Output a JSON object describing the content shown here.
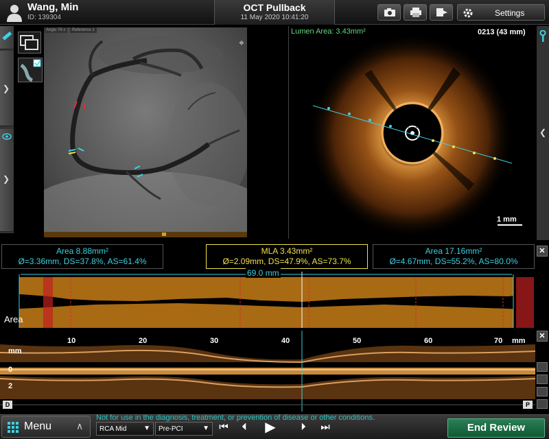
{
  "header": {
    "patient_name": "Wang, Min",
    "patient_id": "ID: 139304",
    "title": "OCT Pullback",
    "datetime": "11 May 2020 10:41:20",
    "settings_label": "Settings"
  },
  "angio": {
    "tabs": [
      "Angio 76 s",
      "Reference 1"
    ],
    "marker_icon": "reference-marker-icon"
  },
  "oct": {
    "lumen_area": "Lumen Area: 3.43mm²",
    "frame": "0213 (43 mm)",
    "scale": "1 mm"
  },
  "measurements": [
    {
      "line1": "Area 8.88mm²",
      "line2": "Ø=3.36mm, DS=37.8%, AS=61.4%",
      "color": "#3ed1e0"
    },
    {
      "line1": "MLA 3.43mm²",
      "line2": "Ø=2.09mm, DS=47.9%, AS=73.7%",
      "color": "#f2e24c"
    },
    {
      "line1": "Area 17.16mm²",
      "line2": "Ø=4.67mm, DS=55.2%, AS=80.0%",
      "color": "#3ed1e0"
    }
  ],
  "area_chart": {
    "label": "Area",
    "length": "69.0 mm"
  },
  "lmode": {
    "ticks": [
      "10",
      "20",
      "30",
      "40",
      "50",
      "60",
      "70"
    ],
    "unit": "mm",
    "y_unit": "mm",
    "y_ticks": [
      "0",
      "2"
    ],
    "left_end": "D",
    "right_end": "P"
  },
  "bottom": {
    "menu_label": "Menu",
    "disclaimer": "Not for use in the diagnosis, treatment, or prevention of disease or other conditions.",
    "vessel": "RCA Mid",
    "stage": "Pre-PCI",
    "end_review": "End Review"
  },
  "colors": {
    "accent_cyan": "#3ed1e0",
    "mla_yellow": "#f2e24c",
    "lumen_green": "#61d97d",
    "end_review_green": "#1b7a4a",
    "area_fill": "#a86a13"
  }
}
